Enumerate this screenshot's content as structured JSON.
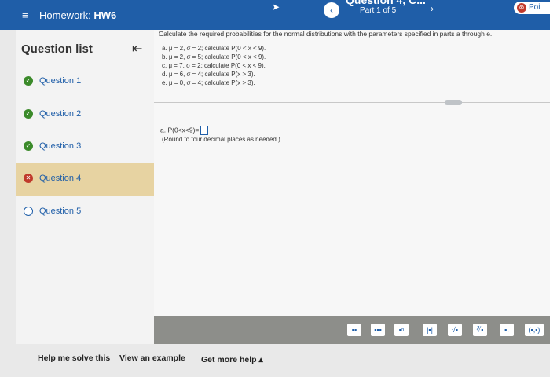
{
  "topbar": {
    "menu_icon": "≡",
    "homework_prefix": "Homework: ",
    "homework_name": "HW6",
    "question_title": "Question 4, C...",
    "part_label": "Part 1 of 5",
    "prev_icon": "‹",
    "next_icon": "›",
    "points_label": "Poi",
    "points_icon": "⊗"
  },
  "sidebar": {
    "header": "Question list",
    "collapse_icon": "⇤",
    "items": [
      {
        "label": "Question 1",
        "status": "correct",
        "mark": "✓"
      },
      {
        "label": "Question 2",
        "status": "correct",
        "mark": "✓"
      },
      {
        "label": "Question 3",
        "status": "correct",
        "mark": "✓"
      },
      {
        "label": "Question 4",
        "status": "incorrect",
        "mark": "✕"
      },
      {
        "label": "Question 5",
        "status": "unanswered",
        "mark": ""
      }
    ]
  },
  "main": {
    "prompt": "Calculate the required probabilities for the normal distributions with the parameters specified in parts a through e.",
    "parts": [
      "a. μ = 2, σ = 2; calculate P(0 < x < 9).",
      "b. μ = 2, σ = 5; calculate P(0 < x < 9).",
      "c. μ = 7, σ = 2; calculate P(0 < x < 9).",
      "d. μ = 6, σ = 4; calculate P(x > 3).",
      "e. μ = 0, σ = 4; calculate P(x > 3)."
    ],
    "answer_label": "a. P(0<x<9)=",
    "answer_value": "",
    "round_note": "(Round to four decimal places as needed.)"
  },
  "mathbar": {
    "tools": [
      "▪▪",
      "▪▪▪",
      "▪ⁿ",
      "|▪|",
      "√▪",
      "∛▪",
      "▪.",
      "(▪,▪)"
    ]
  },
  "bottombar": {
    "help_label": "Help me solve this",
    "example_label": "View an example",
    "more_help_label": "Get more help ▴"
  },
  "colors": {
    "topbar": "#1f5ea8",
    "active_item": "#e7d3a2",
    "correct": "#3b8a2a",
    "incorrect": "#c0392b"
  }
}
